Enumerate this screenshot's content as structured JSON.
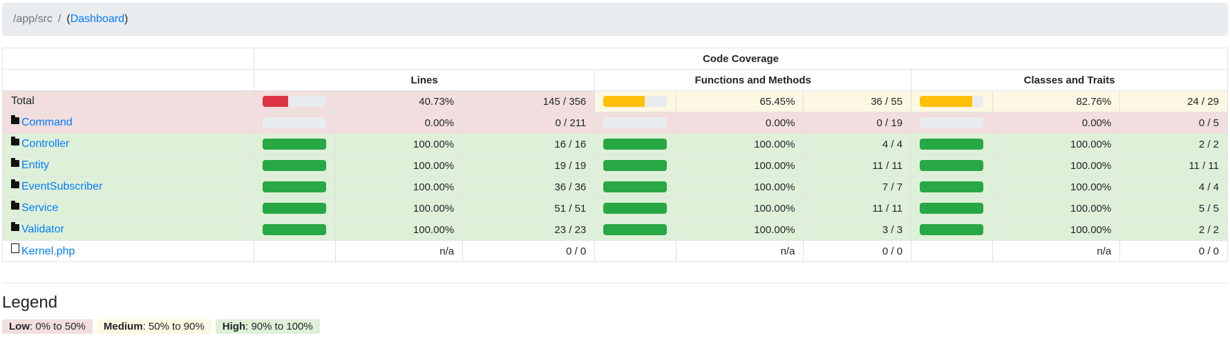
{
  "breadcrumb": {
    "path": "/app/src",
    "separator": "/",
    "open": "(",
    "link": "Dashboard",
    "close": ")"
  },
  "table": {
    "super_header": "Code Coverage",
    "groups": [
      "Lines",
      "Functions and Methods",
      "Classes and Traits"
    ],
    "rows": [
      {
        "name": "Total",
        "kind": "total",
        "lines": {
          "pct": 40.73,
          "pct_text": "40.73%",
          "ratio": "145 / 356",
          "level": "low"
        },
        "funcs": {
          "pct": 65.45,
          "pct_text": "65.45%",
          "ratio": "36 / 55",
          "level": "medium"
        },
        "classes": {
          "pct": 82.76,
          "pct_text": "82.76%",
          "ratio": "24 / 29",
          "level": "medium"
        }
      },
      {
        "name": "Command",
        "kind": "dir",
        "lines": {
          "pct": 0,
          "pct_text": "0.00%",
          "ratio": "0 / 211",
          "level": "low"
        },
        "funcs": {
          "pct": 0,
          "pct_text": "0.00%",
          "ratio": "0 / 19",
          "level": "low"
        },
        "classes": {
          "pct": 0,
          "pct_text": "0.00%",
          "ratio": "0 / 5",
          "level": "low"
        }
      },
      {
        "name": "Controller",
        "kind": "dir",
        "lines": {
          "pct": 100,
          "pct_text": "100.00%",
          "ratio": "16 / 16",
          "level": "high"
        },
        "funcs": {
          "pct": 100,
          "pct_text": "100.00%",
          "ratio": "4 / 4",
          "level": "high"
        },
        "classes": {
          "pct": 100,
          "pct_text": "100.00%",
          "ratio": "2 / 2",
          "level": "high"
        }
      },
      {
        "name": "Entity",
        "kind": "dir",
        "lines": {
          "pct": 100,
          "pct_text": "100.00%",
          "ratio": "19 / 19",
          "level": "high"
        },
        "funcs": {
          "pct": 100,
          "pct_text": "100.00%",
          "ratio": "11 / 11",
          "level": "high"
        },
        "classes": {
          "pct": 100,
          "pct_text": "100.00%",
          "ratio": "11 / 11",
          "level": "high"
        }
      },
      {
        "name": "EventSubscriber",
        "kind": "dir",
        "lines": {
          "pct": 100,
          "pct_text": "100.00%",
          "ratio": "36 / 36",
          "level": "high"
        },
        "funcs": {
          "pct": 100,
          "pct_text": "100.00%",
          "ratio": "7 / 7",
          "level": "high"
        },
        "classes": {
          "pct": 100,
          "pct_text": "100.00%",
          "ratio": "4 / 4",
          "level": "high"
        }
      },
      {
        "name": "Service",
        "kind": "dir",
        "lines": {
          "pct": 100,
          "pct_text": "100.00%",
          "ratio": "51 / 51",
          "level": "high"
        },
        "funcs": {
          "pct": 100,
          "pct_text": "100.00%",
          "ratio": "11 / 11",
          "level": "high"
        },
        "classes": {
          "pct": 100,
          "pct_text": "100.00%",
          "ratio": "5 / 5",
          "level": "high"
        }
      },
      {
        "name": "Validator",
        "kind": "dir",
        "lines": {
          "pct": 100,
          "pct_text": "100.00%",
          "ratio": "23 / 23",
          "level": "high"
        },
        "funcs": {
          "pct": 100,
          "pct_text": "100.00%",
          "ratio": "3 / 3",
          "level": "high"
        },
        "classes": {
          "pct": 100,
          "pct_text": "100.00%",
          "ratio": "2 / 2",
          "level": "high"
        }
      },
      {
        "name": "Kernel.php",
        "kind": "file",
        "lines": {
          "pct": null,
          "pct_text": "n/a",
          "ratio": "0 / 0",
          "level": "none"
        },
        "funcs": {
          "pct": null,
          "pct_text": "n/a",
          "ratio": "0 / 0",
          "level": "none"
        },
        "classes": {
          "pct": null,
          "pct_text": "n/a",
          "ratio": "0 / 0",
          "level": "none"
        }
      }
    ]
  },
  "legend": {
    "title": "Legend",
    "items": [
      {
        "label": "Low",
        "range": ": 0% to 50%"
      },
      {
        "label": "Medium",
        "range": ": 50% to 90%"
      },
      {
        "label": "High",
        "range": ": 90% to 100%"
      }
    ]
  },
  "colors": {
    "low": "#f2dede",
    "medium": "#fcf8e3",
    "high": "#dff0d8",
    "bar_low": "#dc3545",
    "bar_medium": "#ffc107",
    "bar_high": "#28a745",
    "link": "#007bff"
  }
}
